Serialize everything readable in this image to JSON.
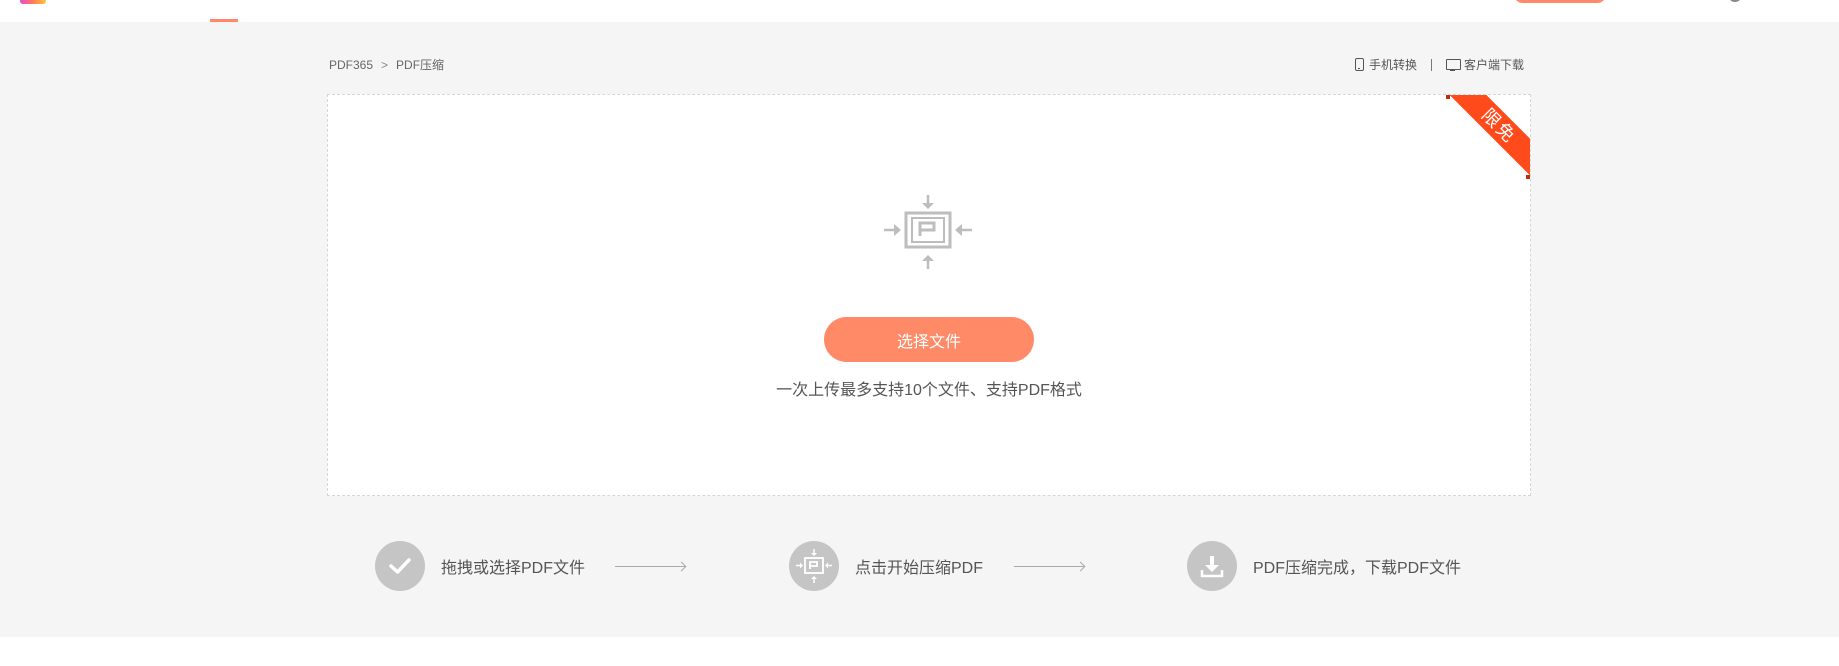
{
  "breadcrumb": {
    "home": "PDF365",
    "separator": ">",
    "current": "PDF压缩"
  },
  "tools": {
    "mobile_label": "手机转换",
    "client_label": "客户端下载"
  },
  "upload": {
    "ribbon_text": "限免",
    "select_button": "选择文件",
    "hint": "一次上传最多支持10个文件、支持PDF格式"
  },
  "steps": [
    {
      "label": "拖拽或选择PDF文件",
      "icon": "check-icon"
    },
    {
      "label": "点击开始压缩PDF",
      "icon": "compress-icon"
    },
    {
      "label": "PDF压缩完成，下载PDF文件",
      "icon": "download-icon"
    }
  ],
  "colors": {
    "accent": "#ff8a68",
    "ribbon": "#ff4a1c",
    "background": "#f5f5f5",
    "icon_gray": "#bdbdbd"
  }
}
